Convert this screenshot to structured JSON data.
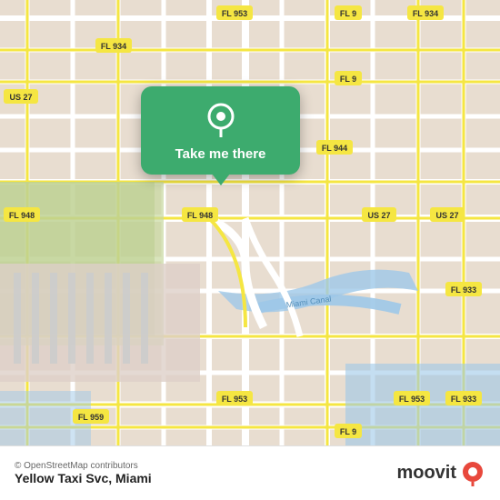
{
  "map": {
    "background_color": "#e8ddd0",
    "osm_credit": "© OpenStreetMap contributors"
  },
  "popup": {
    "label": "Take me there",
    "pin_icon": "location-pin",
    "bg_color": "#3dab6e"
  },
  "bottom_bar": {
    "app_title": "Yellow Taxi Svc, Miami",
    "osm_credit": "© OpenStreetMap contributors",
    "moovit_label": "moovit"
  }
}
